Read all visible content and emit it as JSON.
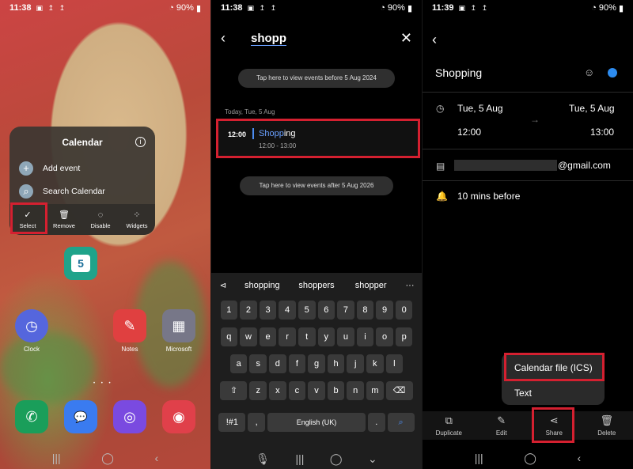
{
  "panel1": {
    "status": {
      "time": "11:38",
      "icons": "▣ ↥ ↥",
      "battery": "90%"
    },
    "popup": {
      "title": "Calendar",
      "items": [
        {
          "label": "Add event",
          "icon": "+"
        },
        {
          "label": "Search Calendar",
          "icon": "⌕"
        }
      ],
      "actions": [
        {
          "label": "Select",
          "icon": "✓"
        },
        {
          "label": "Remove",
          "icon": "🗑"
        },
        {
          "label": "Disable",
          "icon": "◌"
        },
        {
          "label": "Widgets",
          "icon": "⁘"
        }
      ]
    },
    "calendar_icon_day": "5",
    "apps": [
      {
        "label": "Clock",
        "color": "#5566dd",
        "glyph": "◷"
      },
      {
        "label": "Notes",
        "color": "#e04040",
        "glyph": "✎"
      },
      {
        "label": "Microsoft",
        "color": "#777788",
        "glyph": "▦"
      }
    ],
    "dock": [
      {
        "color": "#1a9e5a",
        "glyph": "✆"
      },
      {
        "color": "#3a7bf0",
        "glyph": "💬"
      },
      {
        "color": "#7a4ae0",
        "glyph": "◎"
      },
      {
        "color": "#e0404a",
        "glyph": "◉"
      }
    ]
  },
  "panel2": {
    "status": {
      "time": "11:38",
      "icons": "▣ ↥ ↥",
      "battery": "90%"
    },
    "query": "shopp",
    "pill_before": "Tap here to view events before 5 Aug 2024",
    "date_head": "Today, Tue, 5 Aug",
    "event": {
      "time": "12:00",
      "title_hl": "Shopp",
      "title_rest": "ing",
      "range": "12:00 - 13:00"
    },
    "pill_after": "Tap here to view events after 5 Aug 2026",
    "suggestions": [
      "shopping",
      "shoppers",
      "shopper"
    ],
    "keyboard": {
      "row1": [
        "1",
        "2",
        "3",
        "4",
        "5",
        "6",
        "7",
        "8",
        "9",
        "0"
      ],
      "row2": [
        "q",
        "w",
        "e",
        "r",
        "t",
        "y",
        "u",
        "i",
        "o",
        "p"
      ],
      "row3": [
        "a",
        "s",
        "d",
        "f",
        "g",
        "h",
        "j",
        "k",
        "l"
      ],
      "row4": [
        "z",
        "x",
        "c",
        "v",
        "b",
        "n",
        "m"
      ],
      "sym": "!#1",
      "comma": ",",
      "space": "English (UK)",
      "period": "."
    }
  },
  "panel3": {
    "status": {
      "time": "11:39",
      "icons": "▣ ↥ ↥",
      "battery": "90%"
    },
    "title": "Shopping",
    "start_date": "Tue, 5 Aug",
    "end_date": "Tue, 5 Aug",
    "start_time": "12:00",
    "end_time": "13:00",
    "email_suffix": "@gmail.com",
    "reminder": "10 mins before",
    "share_menu": [
      "Calendar file (ICS)",
      "Text"
    ],
    "actions": [
      {
        "label": "Duplicate",
        "icon": "⧉"
      },
      {
        "label": "Edit",
        "icon": "✎"
      },
      {
        "label": "Share",
        "icon": "⋖"
      },
      {
        "label": "Delete",
        "icon": "🗑"
      }
    ]
  }
}
